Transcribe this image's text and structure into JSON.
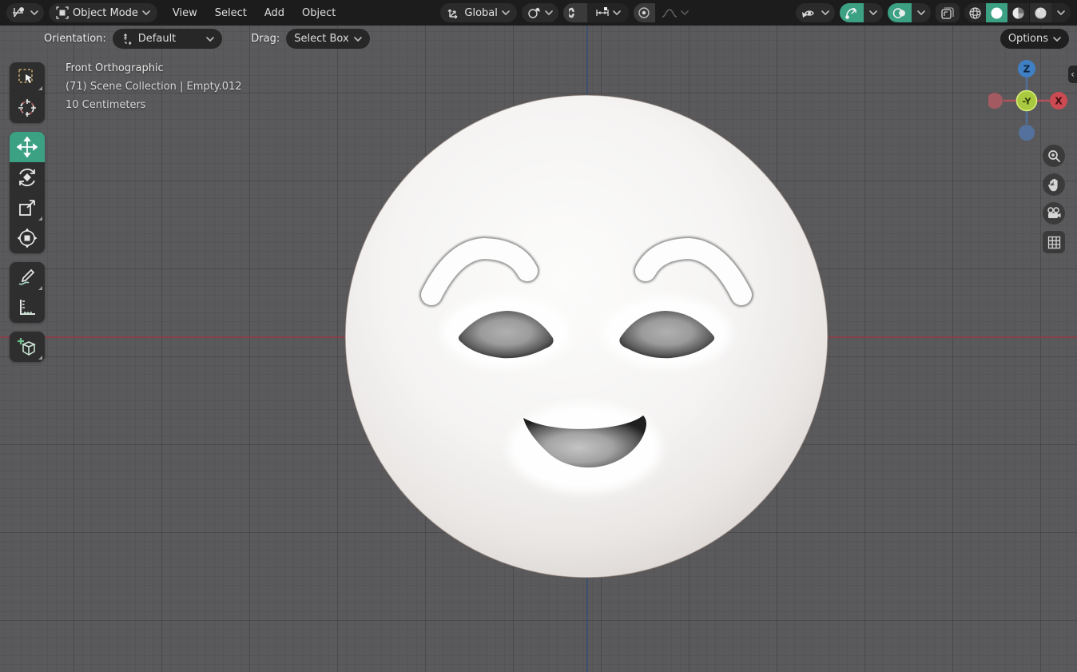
{
  "colors": {
    "accent": "#3ba182",
    "header_bg": "#1c1c1c",
    "button_bg": "#2b2b2b",
    "viewport_bg": "#5a5a5c",
    "axis_x": "#8f3e45",
    "axis_z": "#3c4e70"
  },
  "header": {
    "mode": {
      "label": "Object Mode"
    },
    "menus": [
      {
        "label": "View"
      },
      {
        "label": "Select"
      },
      {
        "label": "Add"
      },
      {
        "label": "Object"
      }
    ],
    "transform_orientation": {
      "label": "Global"
    }
  },
  "tool_settings": {
    "orientation_label": "Orientation:",
    "orientation_value": "Default",
    "drag_label": "Drag:",
    "drag_value": "Select Box",
    "options_label": "Options"
  },
  "viewport": {
    "info": {
      "view_name": "Front Orthographic",
      "collection": "(71) Scene Collection | Empty.012",
      "scale": "10 Centimeters"
    },
    "gizmo_axes": {
      "top": "Z",
      "right": "X",
      "center": "-Y"
    }
  },
  "icons": {
    "collapse_arrow": "‹"
  }
}
